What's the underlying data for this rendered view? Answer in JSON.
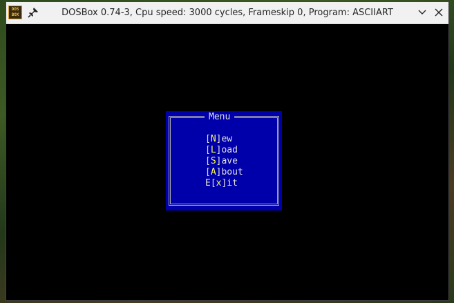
{
  "window": {
    "app_icon_text": "DOS BOX",
    "title": "DOSBox 0.74-3, Cpu speed: 3000 cycles, Frameskip 0, Program: ASCIIART",
    "icons": {
      "app": "dosbox-logo-icon",
      "pin": "pin-icon",
      "minimize": "chevron-down-icon",
      "close": "close-icon"
    }
  },
  "menu": {
    "title": "Menu",
    "items": [
      {
        "prefix": "[",
        "hotkey": "N",
        "suffix": "]ew"
      },
      {
        "prefix": "[",
        "hotkey": "L",
        "suffix": "]oad"
      },
      {
        "prefix": "[",
        "hotkey": "S",
        "suffix": "]ave"
      },
      {
        "prefix": "[",
        "hotkey": "A",
        "suffix": "]bout"
      },
      {
        "prefix": "E[",
        "hotkey": "x",
        "suffix": "]it"
      }
    ],
    "colors": {
      "background": "#0000aa",
      "text": "#e0e0e0",
      "hotkey": "#ffff55",
      "border": "#aaaaaa"
    }
  }
}
